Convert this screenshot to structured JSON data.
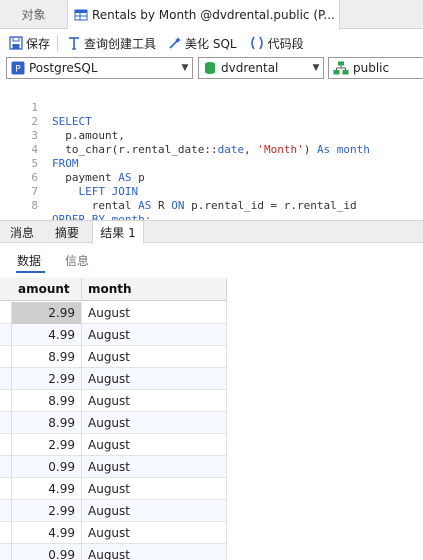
{
  "tabs": {
    "objects_label": "对象",
    "query_label": "Rentals by Month @dvdrental.public (P..."
  },
  "toolbar": {
    "save_label": "保存",
    "query_builder_label": "查询创建工具",
    "beautify_label": "美化 SQL",
    "snippet_label": "代码段"
  },
  "selectors": {
    "connection": "PostgreSQL",
    "database": "dvdrental",
    "schema": "public"
  },
  "editor": {
    "line_numbers": [
      "1",
      "2",
      "3",
      "4",
      "5",
      "6",
      "7",
      "8"
    ],
    "lines": [
      [
        "SELECT"
      ],
      [
        "  p.amount,"
      ],
      [
        "  to_char(r.rental_date::",
        "date",
        ", ",
        "'Month'",
        ") ",
        "As",
        " month"
      ],
      [
        "FROM"
      ],
      [
        "  payment ",
        "AS",
        " p"
      ],
      [
        "    ",
        "LEFT JOIN"
      ],
      [
        "      rental ",
        "AS",
        " R ",
        "ON",
        " p.rental_id = r.rental_id"
      ],
      [
        "ORDER BY",
        " month;"
      ]
    ]
  },
  "result_tabs": {
    "messages": "消息",
    "summary": "摘要",
    "result1": "结果 1"
  },
  "sub_tabs": {
    "data": "数据",
    "info": "信息"
  },
  "grid": {
    "columns": [
      "amount",
      "month"
    ],
    "rows": [
      {
        "amount": "2.99",
        "month": "August"
      },
      {
        "amount": "4.99",
        "month": "August"
      },
      {
        "amount": "8.99",
        "month": "August"
      },
      {
        "amount": "2.99",
        "month": "August"
      },
      {
        "amount": "8.99",
        "month": "August"
      },
      {
        "amount": "8.99",
        "month": "August"
      },
      {
        "amount": "2.99",
        "month": "August"
      },
      {
        "amount": "0.99",
        "month": "August"
      },
      {
        "amount": "4.99",
        "month": "August"
      },
      {
        "amount": "2.99",
        "month": "August"
      },
      {
        "amount": "4.99",
        "month": "August"
      },
      {
        "amount": "0.99",
        "month": "August"
      }
    ]
  },
  "colors": {
    "keyword": "#2f61c9",
    "string": "#c02b2b",
    "selected_cell": "#cfcfcf"
  },
  "icons": [
    "save-icon",
    "query-builder-icon",
    "beautify-icon",
    "snippet-icon",
    "table-icon",
    "postgres-icon",
    "database-icon",
    "schema-icon",
    "chevron-down-icon"
  ]
}
